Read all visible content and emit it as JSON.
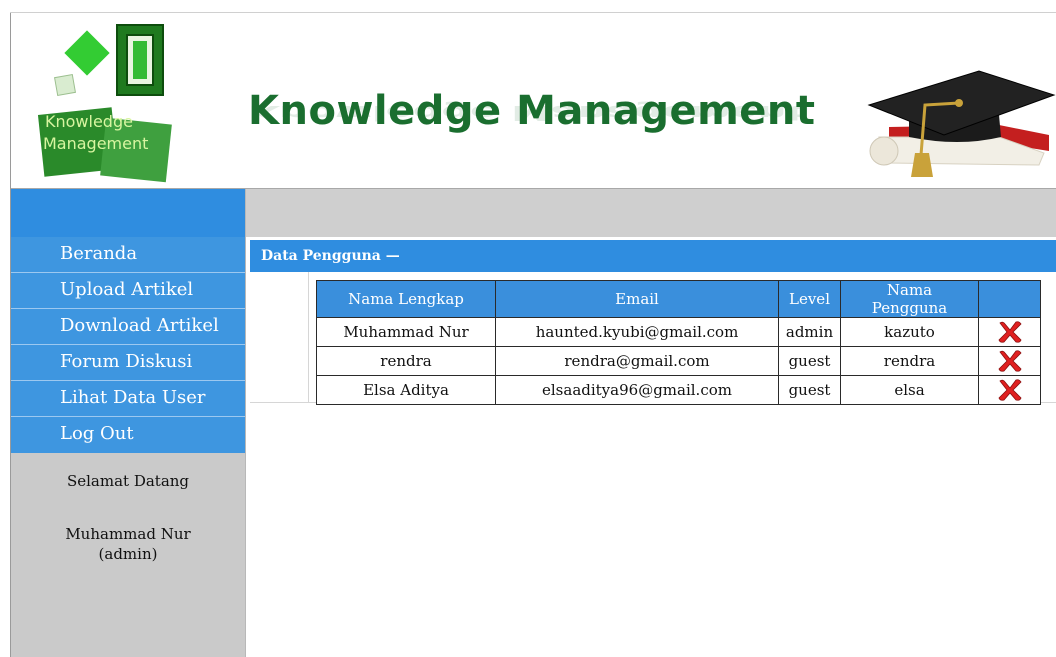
{
  "header": {
    "logo_line1": "Knowledge",
    "logo_line2": "Management",
    "title": "Knowledge Management"
  },
  "sidebar": {
    "menu": [
      {
        "label": "Beranda"
      },
      {
        "label": "Upload Artikel"
      },
      {
        "label": "Download Artikel"
      },
      {
        "label": "Forum Diskusi"
      },
      {
        "label": "Lihat Data User"
      },
      {
        "label": "Log Out"
      }
    ],
    "welcome": "Selamat Datang",
    "user_name": "Muhammad Nur",
    "user_role": "(admin)"
  },
  "content": {
    "section_title": "Data Pengguna —",
    "table": {
      "columns": [
        "Nama Lengkap",
        "Email",
        "Level",
        "Nama Pengguna",
        ""
      ],
      "rows": [
        {
          "nama": "Muhammad Nur",
          "email": "haunted.kyubi@gmail.com",
          "level": "admin",
          "username": "kazuto"
        },
        {
          "nama": "rendra",
          "email": "rendra@gmail.com",
          "level": "guest",
          "username": "rendra"
        },
        {
          "nama": "Elsa Aditya",
          "email": "elsaaditya96@gmail.com",
          "level": "guest",
          "username": "elsa"
        }
      ],
      "delete_icon": "delete-x-icon"
    }
  },
  "colors": {
    "accent_blue": "#2f8de0",
    "menu_blue": "#3e96e0",
    "title_green": "#1a6e2f",
    "delete_red": "#e02020"
  }
}
